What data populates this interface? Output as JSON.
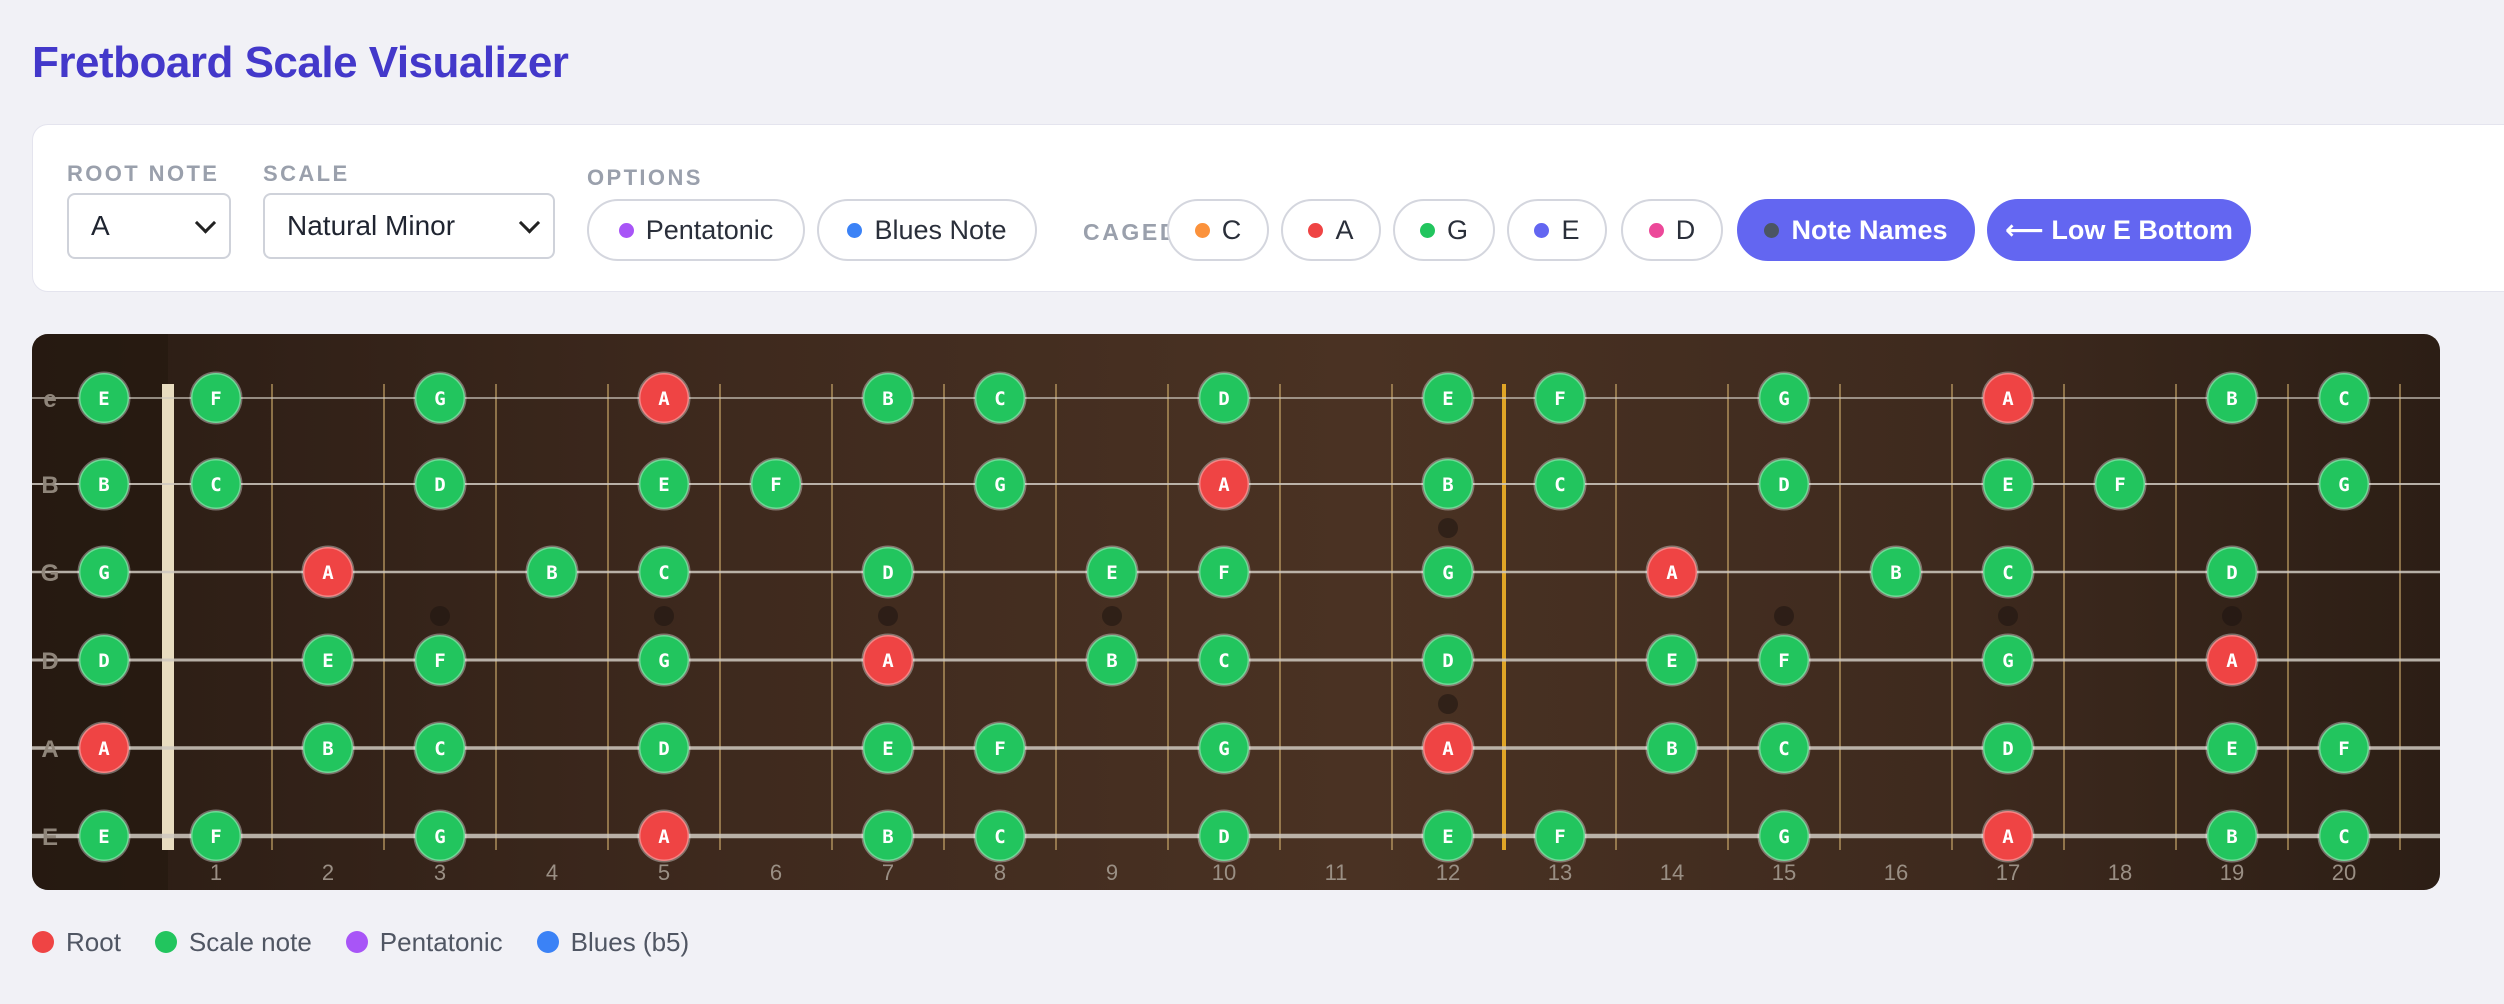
{
  "app": {
    "title": "Fretboard Scale Visualizer"
  },
  "controls": {
    "root_label": "ROOT NOTE",
    "root_value": "A",
    "scale_label": "SCALE",
    "scale_value": "Natural Minor",
    "options_label": "OPTIONS",
    "pentatonic": {
      "label": "Pentatonic",
      "color": "#a855f7"
    },
    "blues": {
      "label": "Blues Note",
      "color": "#3b82f6"
    },
    "caged_label": "CAGED:",
    "caged": [
      {
        "label": "C",
        "color": "#fb923c"
      },
      {
        "label": "A",
        "color": "#ef4444"
      },
      {
        "label": "G",
        "color": "#22c55e"
      },
      {
        "label": "E",
        "color": "#6366f1"
      },
      {
        "label": "D",
        "color": "#ec4899"
      }
    ],
    "note_names": {
      "label": "Note Names",
      "color": "#4b5563"
    },
    "orientation": {
      "label": "⟵ Low E Bottom"
    }
  },
  "fretboard": {
    "strings": [
      "e",
      "B",
      "G",
      "D",
      "A",
      "E"
    ],
    "fret_numbers": [
      "1",
      "2",
      "3",
      "4",
      "5",
      "6",
      "7",
      "8",
      "9",
      "10",
      "11",
      "12",
      "13",
      "14",
      "15",
      "16",
      "17",
      "18",
      "19",
      "20"
    ],
    "root_color": "#ef4444",
    "scale_color": "#22c55e",
    "notes": [
      [
        "E",
        "F",
        "",
        "G",
        "",
        "A",
        "",
        "B",
        "C",
        "",
        "D",
        "",
        "E",
        "F",
        "",
        "G",
        "",
        "A",
        "",
        "B",
        "C"
      ],
      [
        "B",
        "C",
        "",
        "D",
        "",
        "E",
        "F",
        "",
        "G",
        "",
        "A",
        "",
        "B",
        "C",
        "",
        "D",
        "",
        "E",
        "F",
        "",
        "G"
      ],
      [
        "G",
        "",
        "A",
        "",
        "B",
        "C",
        "",
        "D",
        "",
        "E",
        "F",
        "",
        "G",
        "",
        "A",
        "",
        "B",
        "C",
        "",
        "D",
        ""
      ],
      [
        "D",
        "",
        "E",
        "F",
        "",
        "G",
        "",
        "A",
        "",
        "B",
        "C",
        "",
        "D",
        "",
        "E",
        "F",
        "",
        "G",
        "",
        "A",
        ""
      ],
      [
        "A",
        "",
        "B",
        "C",
        "",
        "D",
        "",
        "E",
        "F",
        "",
        "G",
        "",
        "A",
        "",
        "B",
        "C",
        "",
        "D",
        "",
        "E",
        "F"
      ],
      [
        "E",
        "F",
        "",
        "G",
        "",
        "A",
        "",
        "B",
        "C",
        "",
        "D",
        "",
        "E",
        "F",
        "",
        "G",
        "",
        "A",
        "",
        "B",
        "C"
      ]
    ],
    "root_note": "A"
  },
  "legend": [
    {
      "label": "Root",
      "color": "#ef4444"
    },
    {
      "label": "Scale note",
      "color": "#22c55e"
    },
    {
      "label": "Pentatonic",
      "color": "#a855f7"
    },
    {
      "label": "Blues (b5)",
      "color": "#3b82f6"
    }
  ]
}
